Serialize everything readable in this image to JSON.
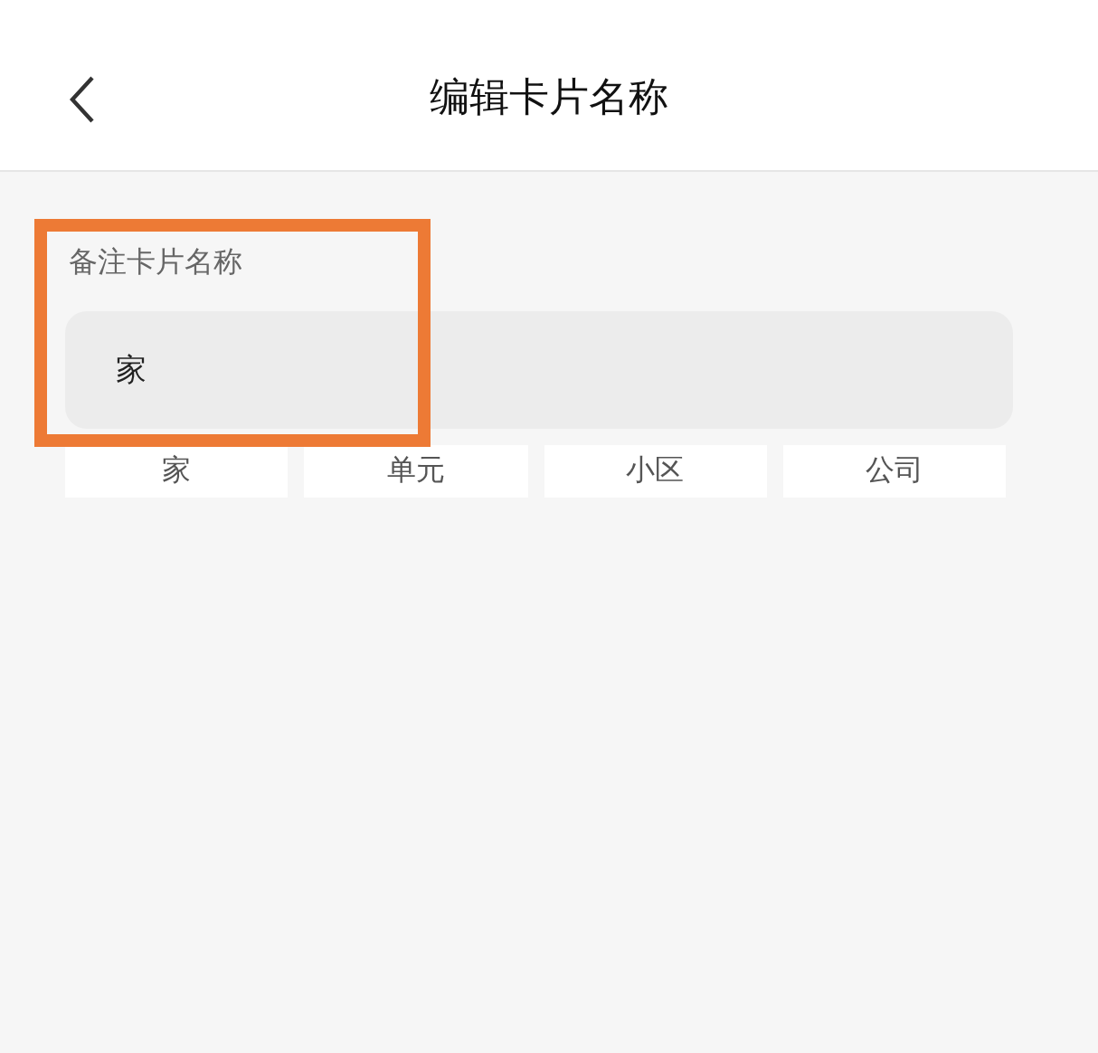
{
  "header": {
    "title": "编辑卡片名称"
  },
  "form": {
    "label": "备注卡片名称",
    "value": "家"
  },
  "suggestions": [
    "家",
    "单元",
    "小区",
    "公司"
  ],
  "highlight": {
    "shown": true
  }
}
